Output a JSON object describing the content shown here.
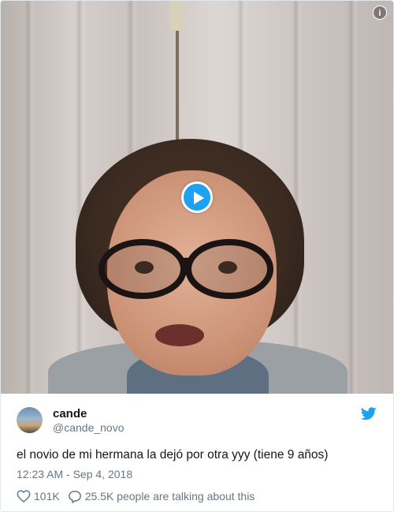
{
  "media": {
    "type": "video",
    "play_icon": "play-icon",
    "info_icon_label": "i"
  },
  "tweet": {
    "display_name": "cande",
    "screen_name": "@cande_novo",
    "text": "el novio de mi hermana la dejó por otra yyy (tiene 9 años)",
    "timestamp": "12:23 AM - Sep 4, 2018",
    "likes": "101K",
    "replies_text": "25.5K people are talking about this"
  },
  "colors": {
    "brand": "#1da1f2",
    "text": "#14171a",
    "secondary": "#657786",
    "border": "#e1e8ed"
  },
  "icons": [
    "info-icon",
    "play-icon",
    "twitter-bird-icon",
    "heart-icon",
    "reply-icon"
  ]
}
